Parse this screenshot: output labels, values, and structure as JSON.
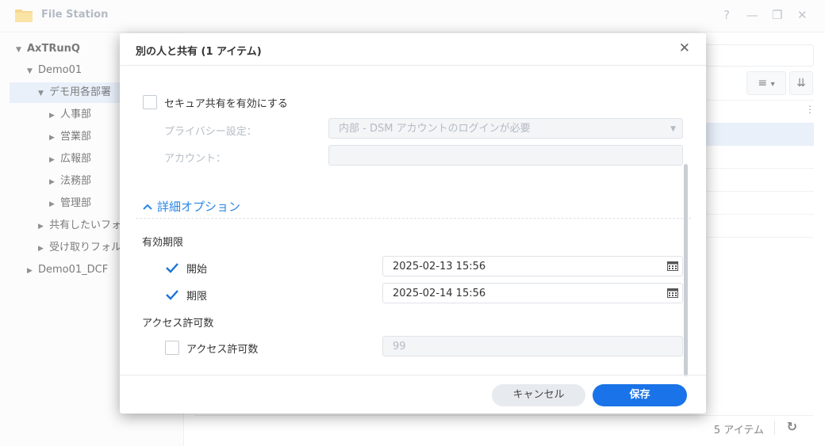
{
  "app": {
    "title": "File Station"
  },
  "window_controls": {
    "help": "?",
    "minimize": "—",
    "maximize": "❐",
    "close": "✕"
  },
  "sidebar": {
    "items": [
      {
        "label": "AxTRunQ",
        "arrow": "▼"
      },
      {
        "label": "Demo01",
        "arrow": "▼"
      },
      {
        "label": "デモ用各部署",
        "arrow": "▼"
      },
      {
        "label": "人事部",
        "arrow": "▶"
      },
      {
        "label": "営業部",
        "arrow": "▶"
      },
      {
        "label": "広報部",
        "arrow": "▶"
      },
      {
        "label": "法務部",
        "arrow": "▶"
      },
      {
        "label": "管理部",
        "arrow": "▶"
      },
      {
        "label": "共有したいフォ",
        "arrow": "▶"
      },
      {
        "label": "受け取りフォル",
        "arrow": "▶"
      },
      {
        "label": "Demo01_DCF",
        "arrow": "▶"
      }
    ]
  },
  "toolbar": {
    "list_view_icon": "≡",
    "dropdown_icon": "▾",
    "sort_icon": "⇊",
    "more_icon": "⋮"
  },
  "status": {
    "item_count": "5 アイテム",
    "refresh_icon": "↻"
  },
  "dialog": {
    "title": "別の人と共有 (1 アイテム)",
    "close": "✕",
    "secure_share": {
      "label": "セキュア共有を有効にする",
      "checked": false
    },
    "privacy": {
      "label": "プライバシー設定：",
      "value": "内部 - DSM アカウントのログインが必要"
    },
    "account": {
      "label": "アカウント：",
      "value": ""
    },
    "advanced": {
      "label": "詳細オプション",
      "toggle_icon": "^"
    },
    "validity": {
      "heading": "有効期限",
      "start": {
        "label": "開始",
        "checked": true,
        "value": "2025-02-13 15:56"
      },
      "end": {
        "label": "期限",
        "checked": true,
        "value": "2025-02-14 15:56"
      }
    },
    "access_limit": {
      "heading": "アクセス許可数",
      "label": "アクセス許可数",
      "checked": false,
      "value": "99"
    },
    "buttons": {
      "cancel": "キャンセル",
      "save": "保存"
    }
  },
  "colors": {
    "accent": "#1a73e8",
    "link": "#2a86e6",
    "selected_row": "#dde9f7"
  }
}
